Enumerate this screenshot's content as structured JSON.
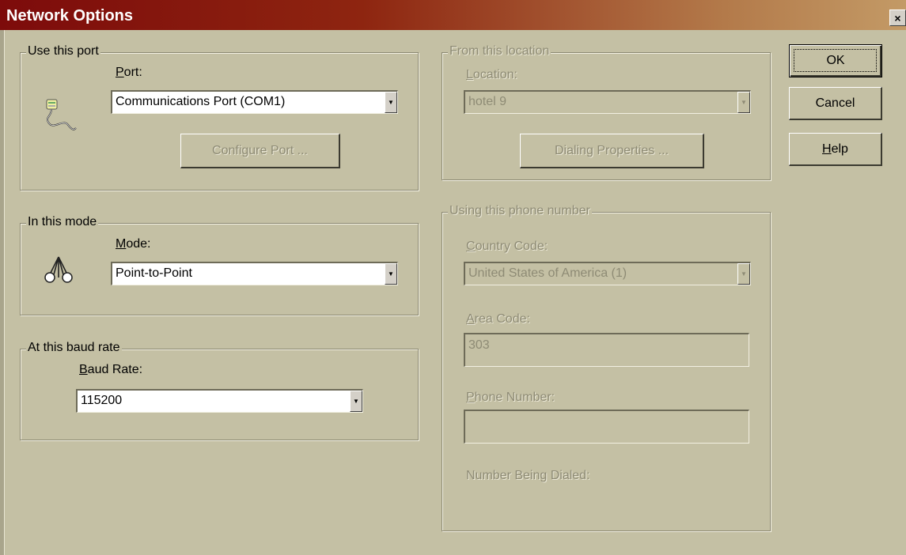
{
  "window": {
    "title": "Network Options",
    "close_glyph": "×"
  },
  "port_group": {
    "legend": "Use this port",
    "label": "Port:",
    "icon": "serial-cable-icon",
    "selected": "Communications Port (COM1)",
    "configure_button": "Configure Port ..."
  },
  "mode_group": {
    "legend": "In this mode",
    "label": "Mode:",
    "icon": "network-mode-icon",
    "selected": "Point-to-Point"
  },
  "baud_group": {
    "legend": "At this baud rate",
    "label": "Baud Rate:",
    "selected": "115200"
  },
  "location_group": {
    "legend": "From this location",
    "label": "Location:",
    "selected": "hotel 9",
    "dialing_button": "Dialing Properties ..."
  },
  "phone_group": {
    "legend": "Using this phone number",
    "country_label": "Country Code:",
    "country_selected": "United States of America (1)",
    "area_label": "Area Code:",
    "area_value": "303",
    "phone_label": "Phone Number:",
    "phone_value": "",
    "dialed_label": "Number Being Dialed:"
  },
  "buttons": {
    "ok": "OK",
    "cancel": "Cancel",
    "help": "Help"
  },
  "dropdown_glyph": "▼",
  "colors": {
    "face": "#c4c0a4",
    "title_start": "#7d0b0b",
    "title_end": "#c39a66",
    "disabled_text": "#8e8b75"
  }
}
